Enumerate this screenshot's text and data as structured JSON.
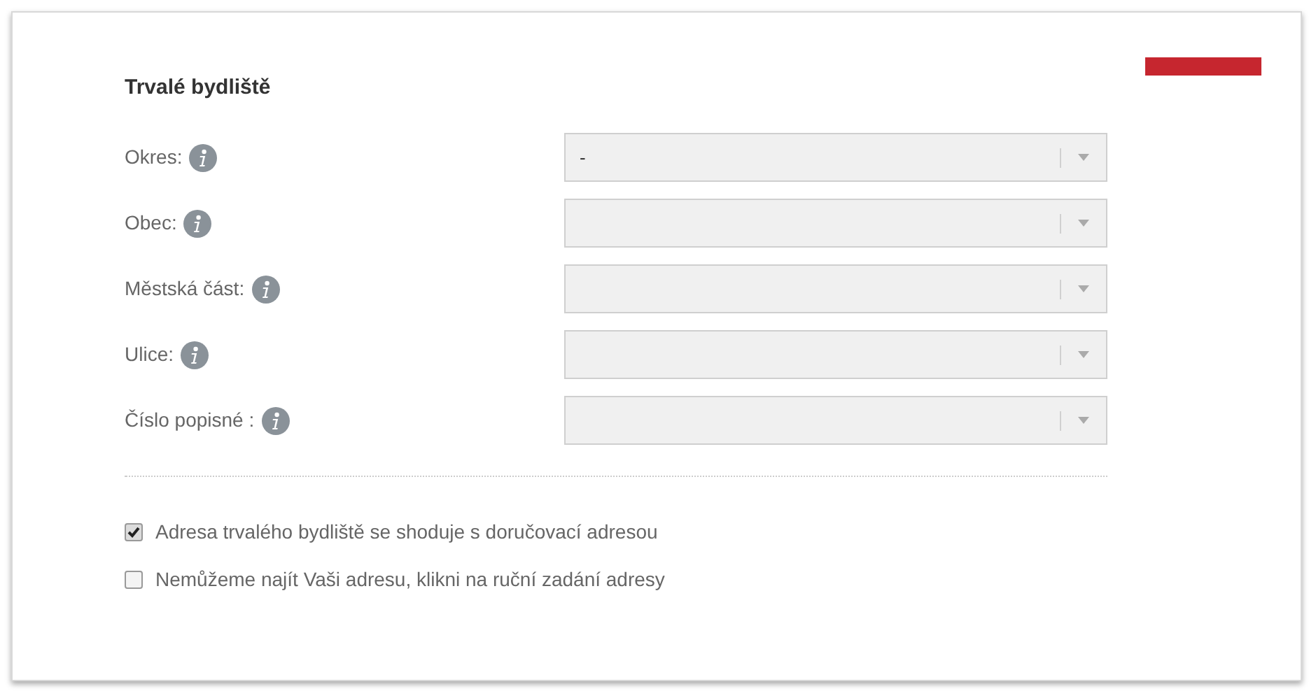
{
  "section": {
    "title": "Trvalé bydliště"
  },
  "fields": [
    {
      "label": "Okres:",
      "value": "-"
    },
    {
      "label": "Obec:"
    },
    {
      "label": "Městská část:"
    },
    {
      "label": "Ulice:"
    },
    {
      "label": "Číslo popisné :"
    }
  ],
  "options": [
    {
      "label": "Adresa trvalého bydliště se shoduje s doručovací adresou",
      "checked": true
    },
    {
      "label": "Nemůžeme najít Vaši adresu, klikni na ruční zadání adresy",
      "checked": false
    }
  ]
}
